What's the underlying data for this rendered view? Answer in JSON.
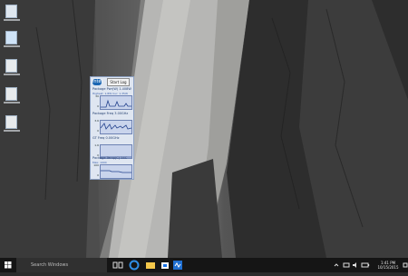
{
  "desktop": {
    "icons": [
      "recycle-bin-icon",
      "document-icon",
      "shortcut-icon",
      "shortcut-icon",
      "shortcut-icon"
    ]
  },
  "gadget": {
    "brand": "intel",
    "start_log_label": "Start Log",
    "panels": [
      {
        "title": "Package Pwr(W)   1.408W",
        "subtitle": "Highest: 1.8W   Cur: 1.35W",
        "axis_top": "30",
        "axis_bottom": "0"
      },
      {
        "title": "Package Freq   3.00GHz",
        "subtitle": "",
        "axis_top": "3.6",
        "axis_bottom": "0"
      },
      {
        "title": "GT Freq    0.00GHz",
        "subtitle": "",
        "axis_top": "1.6",
        "axis_bottom": "0"
      },
      {
        "title": "Package Temp(C)   54C",
        "subtitle": "Max: 100C",
        "axis_top": "100",
        "axis_bottom": "0"
      }
    ]
  },
  "taskbar": {
    "search_placeholder": "Search Windows",
    "apps": [
      "task-view-icon",
      "edge-icon",
      "explorer-icon",
      "store-icon",
      "power-gadget-icon"
    ],
    "clock_time": "1:41 PM",
    "clock_date": "10/15/2015"
  },
  "colors": {
    "taskbar": "#151515",
    "gadget_bg": "#dfe6f1",
    "graph_bg": "#c9d4ec",
    "graph_line": "#24438e"
  }
}
